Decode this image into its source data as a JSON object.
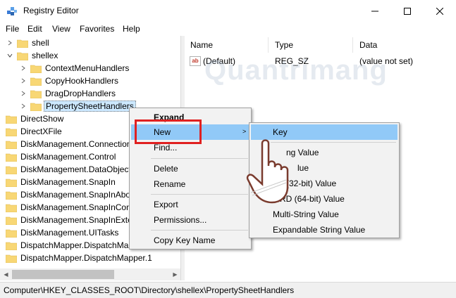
{
  "window": {
    "title": "Registry Editor",
    "icon": "registry-editor-icon",
    "minimize": "minimize-icon",
    "maximize": "maximize-icon",
    "close": "close-icon"
  },
  "menubar": {
    "items": [
      "File",
      "Edit",
      "View",
      "Favorites",
      "Help"
    ]
  },
  "tree": {
    "rows": [
      {
        "label": "shell",
        "expander": "›"
      },
      {
        "label": "shellex",
        "expander": "⌄"
      },
      {
        "label": "ContextMenuHandlers",
        "expander": "›"
      },
      {
        "label": "CopyHookHandlers",
        "expander": "›"
      },
      {
        "label": "DragDropHandlers",
        "expander": "›"
      },
      {
        "label": "PropertySheetHandlers",
        "expander": "›"
      },
      {
        "label": "DirectShow"
      },
      {
        "label": "DirectXFile"
      },
      {
        "label": "DiskManagement.Connection"
      },
      {
        "label": "DiskManagement.Control"
      },
      {
        "label": "DiskManagement.DataObject"
      },
      {
        "label": "DiskManagement.SnapIn"
      },
      {
        "label": "DiskManagement.SnapInAbo"
      },
      {
        "label": "DiskManagement.SnapInCom"
      },
      {
        "label": "DiskManagement.SnapInExte"
      },
      {
        "label": "DiskManagement.UITasks"
      },
      {
        "label": "DispatchMapper.DispatchMa"
      },
      {
        "label": "DispatchMapper.DispatchMapper.1"
      }
    ]
  },
  "list": {
    "columns": [
      "Name",
      "Type",
      "Data"
    ],
    "rows": [
      {
        "name": "(Default)",
        "type": "REG_SZ",
        "data": "(value not set)",
        "icon_text": "ab"
      }
    ]
  },
  "context_menu": {
    "items": [
      "Expand",
      "New",
      "Find...",
      "Delete",
      "Rename",
      "Export",
      "Permissions...",
      "Copy Key Name"
    ],
    "submenu_arrow": ">"
  },
  "submenu": {
    "items": [
      "Key",
      "String Value",
      "Binary Value",
      "DWORD (32-bit) Value",
      "QWORD (64-bit) Value",
      "Multi-String Value",
      "Expandable String Value"
    ],
    "visible_items": [
      "Key",
      "ng Value",
      "lue",
      "(32-bit) Value",
      "RD (64-bit) Value",
      "Multi-String Value",
      "Expandable String Value"
    ]
  },
  "watermark": "Quantrimang",
  "status": {
    "path": "Computer\\HKEY_CLASSES_ROOT\\Directory\\shellex\\PropertySheetHandlers"
  },
  "colors": {
    "folder": "#f8d775",
    "highlight": "#91c9f7",
    "selection": "#cce8ff",
    "red_box": "#e02020"
  }
}
